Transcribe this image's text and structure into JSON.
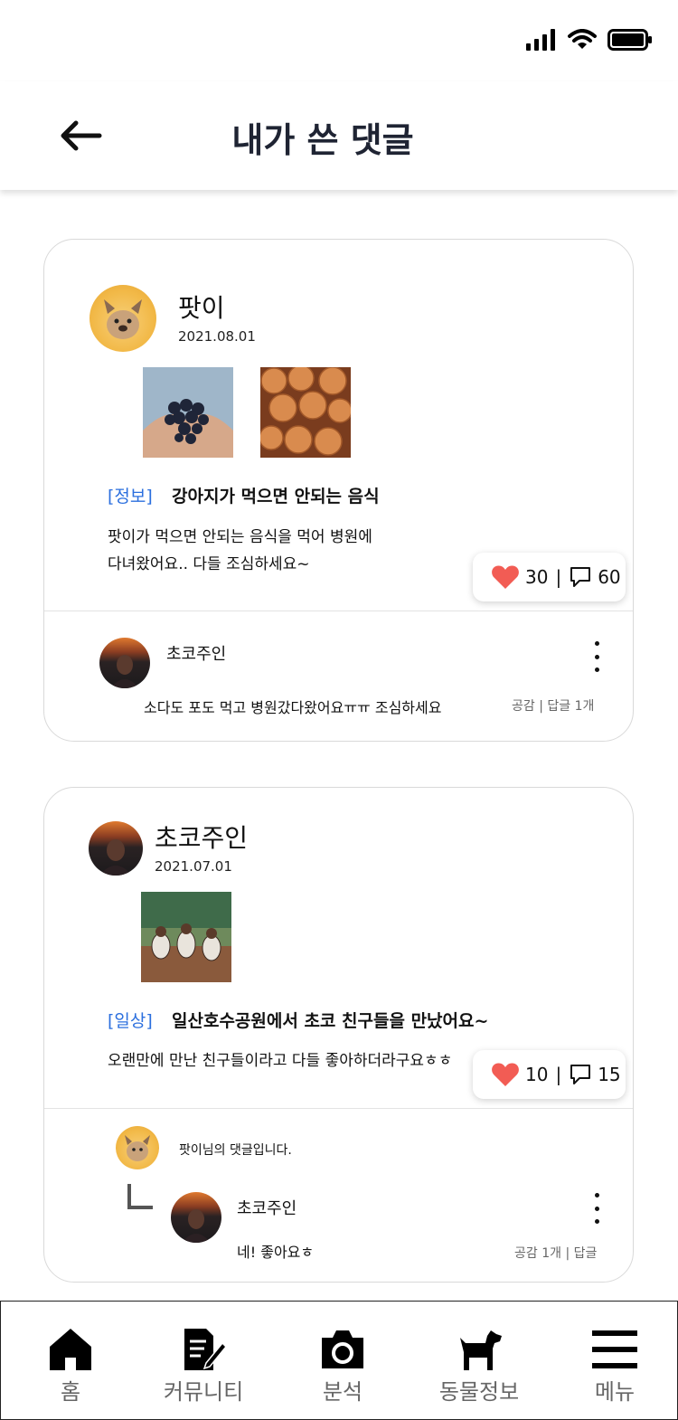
{
  "header": {
    "title": "내가 쓴 댓글"
  },
  "posts": [
    {
      "author": "팟이",
      "date": "2021.08.01",
      "tag": "[정보]",
      "title": "강아지가 먹으면 안되는 음식",
      "body_lines": [
        "팟이가 먹으면 안되는 음식을 먹어 병원에",
        "다녀왔어요.. 다들 조심하세요~"
      ],
      "likes": "30",
      "comments": "60",
      "comment": {
        "author": "초코주인",
        "text": "소다도 포도 먹고 병원갔다왔어요ㅠㅠ 조심하세요",
        "meta": "공감 | 답글 1개"
      }
    },
    {
      "author": "초코주인",
      "date": "2021.07.01",
      "tag": "[일상]",
      "title": "일산호수공원에서 초코 친구들을 만났어요~",
      "body_lines": [
        "오랜만에 만난 친구들이라고 다들 좋아하더라구요ㅎㅎ"
      ],
      "likes": "10",
      "comments": "15",
      "parent_comment": {
        "text": "팟이님의 댓글입니다."
      },
      "reply": {
        "author": "초코주인",
        "text": "네! 좋아요ㅎ",
        "meta": "공감 1개 | 답글"
      }
    }
  ],
  "nav": [
    {
      "label": "홈",
      "icon": "home-icon"
    },
    {
      "label": "커뮤니티",
      "icon": "community-icon"
    },
    {
      "label": "분석",
      "icon": "camera-icon"
    },
    {
      "label": "동물정보",
      "icon": "dog-icon"
    },
    {
      "label": "메뉴",
      "icon": "menu-icon"
    }
  ],
  "colors": {
    "tag_blue": "#2b6fde",
    "heart_red": "#f25c54",
    "title_navy": "#1f2433"
  }
}
